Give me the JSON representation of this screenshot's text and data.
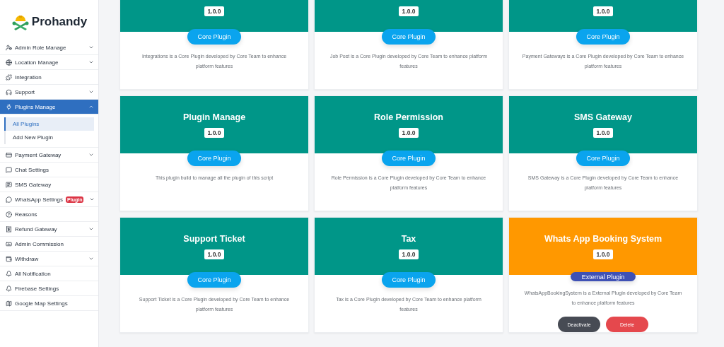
{
  "brand": {
    "name": "Prohandy"
  },
  "sidebar": {
    "items": [
      {
        "label": "Admin Role Manage",
        "expanded": false
      },
      {
        "label": "Location Manage",
        "expanded": false
      },
      {
        "label": "Integration"
      },
      {
        "label": "Support",
        "expanded": false
      },
      {
        "label": "Plugins Manage",
        "expanded": true,
        "selected": true,
        "children": [
          {
            "label": "All Plugins",
            "selected": true
          },
          {
            "label": "Add New Plugin",
            "selected": false
          }
        ]
      },
      {
        "label": "Payment Gateway",
        "expanded": false
      },
      {
        "label": "Chat Settings"
      },
      {
        "label": "SMS Gateway"
      },
      {
        "label": "WhatsApp Settings",
        "badge": "Plugin",
        "expanded": false
      },
      {
        "label": "Reasons"
      },
      {
        "label": "Refund Gateway",
        "expanded": false
      },
      {
        "label": "Admin Commission"
      },
      {
        "label": "Withdraw",
        "expanded": false
      },
      {
        "label": "All Notification"
      },
      {
        "label": "Firebase Settings"
      },
      {
        "label": "Google Map Settings"
      }
    ]
  },
  "plugins": [
    {
      "version": "1.0.0",
      "kind": "core",
      "color": "#009688",
      "type_label": "Core Plugin",
      "description": "Integrations is a Core Plugin developed by Core Team to enhance platform features"
    },
    {
      "version": "1.0.0",
      "kind": "core",
      "color": "#009688",
      "type_label": "Core Plugin",
      "description": "Job Post is a Core Plugin developed by Core Team to enhance platform features"
    },
    {
      "version": "1.0.0",
      "kind": "core",
      "color": "#009688",
      "type_label": "Core Plugin",
      "description": "Payment Gateways is a Core Plugin developed by Core Team to enhance platform features"
    },
    {
      "title": "Plugin Manage",
      "version": "1.0.0",
      "kind": "core",
      "color": "#009688",
      "type_label": "Core Plugin",
      "description": "This plugin build to manage all the plugin of this script"
    },
    {
      "title": "Role Permission",
      "version": "1.0.0",
      "kind": "core",
      "color": "#009688",
      "type_label": "Core Plugin",
      "description": "Role Permission is a Core Plugin developed by Core Team to enhance platform features"
    },
    {
      "title": "SMS Gateway",
      "version": "1.0.0",
      "kind": "core",
      "color": "#009688",
      "type_label": "Core Plugin",
      "description": "SMS Gateway is a Core Plugin developed by Core Team to enhance platform features"
    },
    {
      "title": "Support Ticket",
      "version": "1.0.0",
      "kind": "core",
      "color": "#009688",
      "type_label": "Core Plugin",
      "description": "Support Ticket is a Core Plugin developed by Core Team to enhance platform features"
    },
    {
      "title": "Tax",
      "version": "1.0.0",
      "kind": "core",
      "color": "#009688",
      "type_label": "Core Plugin",
      "description": "Tax is a Core Plugin developed by Core Team to enhance platform features"
    },
    {
      "title": "Whats App Booking System",
      "version": "1.0.0",
      "kind": "external",
      "color": "#ff9800",
      "type_label": "External Plugin",
      "description": "WhatsAppBookingSystem is a External Plugin developed by Core Team to enhance platform features",
      "actions": [
        {
          "label": "Deactivate",
          "kind": "deactivate"
        },
        {
          "label": "Delete",
          "kind": "delete"
        }
      ]
    }
  ]
}
